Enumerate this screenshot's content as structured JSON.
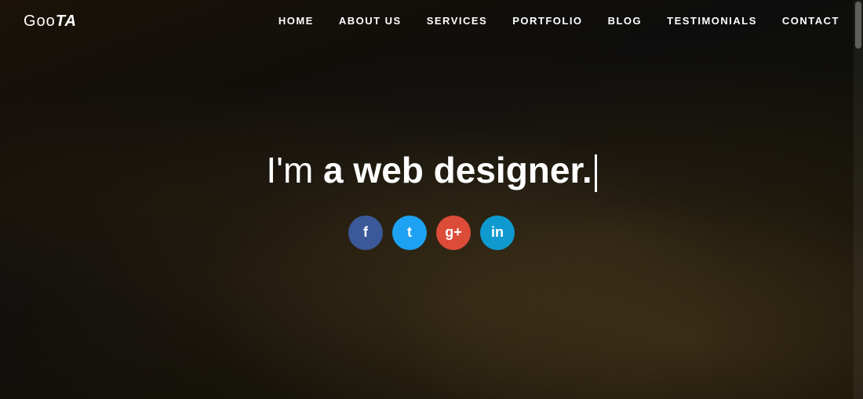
{
  "brand": {
    "logo": "GooTA"
  },
  "nav": {
    "items": [
      {
        "label": "HOME",
        "id": "home"
      },
      {
        "label": "ABOUT US",
        "id": "about"
      },
      {
        "label": "SERVICES",
        "id": "services"
      },
      {
        "label": "PORTFOLIO",
        "id": "portfolio"
      },
      {
        "label": "BLOG",
        "id": "blog"
      },
      {
        "label": "TESTIMONIALS",
        "id": "testimonials"
      },
      {
        "label": "CONTACT",
        "id": "contact"
      }
    ]
  },
  "hero": {
    "headline_prefix": "I'm ",
    "headline_bold": "a web designer.",
    "social": [
      {
        "id": "facebook",
        "icon": "f",
        "label": "Facebook",
        "class": "facebook"
      },
      {
        "id": "twitter",
        "icon": "t",
        "label": "Twitter",
        "class": "twitter"
      },
      {
        "id": "googleplus",
        "icon": "g+",
        "label": "Google Plus",
        "class": "googleplus"
      },
      {
        "id": "linkedin",
        "icon": "in",
        "label": "LinkedIn",
        "class": "linkedin"
      }
    ]
  }
}
